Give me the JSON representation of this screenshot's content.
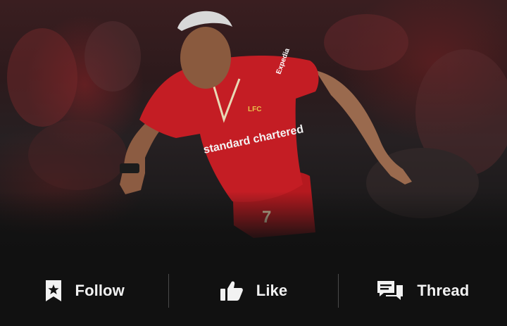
{
  "post_image": {
    "shirt_sponsor": "standard chartered",
    "crest_text": "LFC",
    "sleeve_text": "Expedia",
    "shirt_number": "7"
  },
  "actions": [
    {
      "id": "follow",
      "label": "Follow",
      "icon": "bookmark-star-icon"
    },
    {
      "id": "like",
      "label": "Like",
      "icon": "thumbs-up-icon"
    },
    {
      "id": "thread",
      "label": "Thread",
      "icon": "chat-bubbles-icon"
    }
  ]
}
